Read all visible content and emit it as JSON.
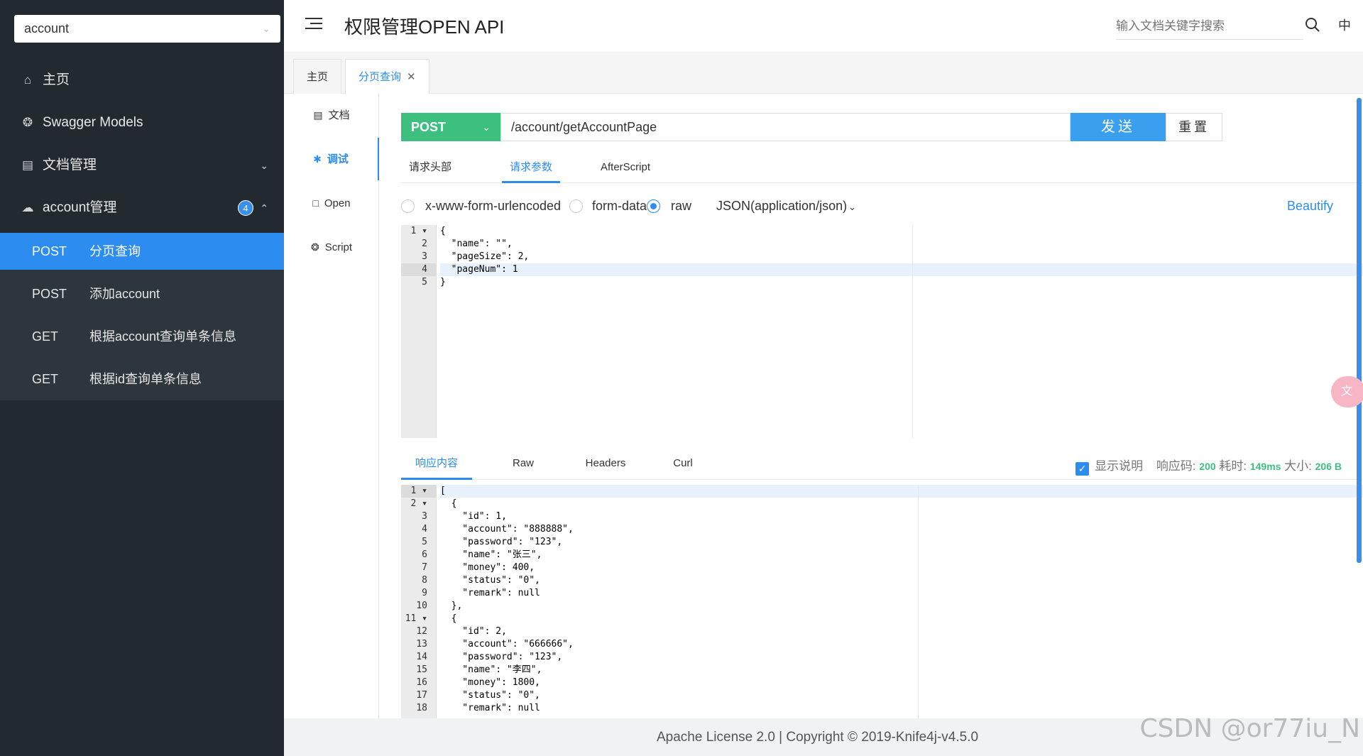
{
  "sidebar": {
    "group_select": "account",
    "items": [
      {
        "label": "主页",
        "icon": "home-icon"
      },
      {
        "label": "Swagger Models",
        "icon": "models-icon"
      },
      {
        "label": "文档管理",
        "icon": "doc-manage-icon"
      },
      {
        "label": "account管理",
        "icon": "cloud-icon",
        "badge": "4"
      }
    ],
    "apis": [
      {
        "method": "POST",
        "name": "分页查询",
        "active": true
      },
      {
        "method": "POST",
        "name": "添加account"
      },
      {
        "method": "GET",
        "name": "根据account查询单条信息"
      },
      {
        "method": "GET",
        "name": "根据id查询单条信息"
      }
    ]
  },
  "header": {
    "title": "权限管理OPEN API",
    "search_placeholder": "输入文档关键字搜索",
    "lang": "中"
  },
  "tabs": [
    {
      "label": "主页"
    },
    {
      "label": "分页查询",
      "active": true
    }
  ],
  "inner_nav": [
    {
      "label": "文档"
    },
    {
      "label": "调试",
      "active": true
    },
    {
      "label": "Open"
    },
    {
      "label": "Script"
    }
  ],
  "request": {
    "method": "POST",
    "url": "/account/getAccountPage",
    "send_label": "发送",
    "reset_label": "重置",
    "tabs": [
      "请求头部",
      "请求参数",
      "AfterScript"
    ],
    "active_tab": "请求参数",
    "body_types": [
      "x-www-form-urlencoded",
      "form-data",
      "raw"
    ],
    "selected_body_type": "raw",
    "content_type": "JSON(application/json)",
    "beautify_label": "Beautify",
    "body_lines": [
      "{",
      "  \"name\": \"\",",
      "  \"pageSize\": 2,",
      "  \"pageNum\": 1",
      "}"
    ]
  },
  "response": {
    "tabs": [
      "响应内容",
      "Raw",
      "Headers",
      "Curl"
    ],
    "active_tab": "响应内容",
    "show_desc_label": "显示说明",
    "show_desc_checked": true,
    "code_label": "响应码:",
    "code": "200",
    "time_label": "耗时:",
    "time": "149ms",
    "size_label": "大小:",
    "size": "206 B",
    "body_lines": [
      "[",
      "  {",
      "    \"id\": 1,",
      "    \"account\": \"888888\",",
      "    \"password\": \"123\",",
      "    \"name\": \"张三\",",
      "    \"money\": 400,",
      "    \"status\": \"0\",",
      "    \"remark\": null",
      "  },",
      "  {",
      "    \"id\": 2,",
      "    \"account\": \"666666\",",
      "    \"password\": \"123\",",
      "    \"name\": \"李四\",",
      "    \"money\": 1800,",
      "    \"status\": \"0\",",
      "    \"remark\": null"
    ]
  },
  "footer": {
    "license": "Apache License 2.0 | Copyright © 2019-Knife4j-v4.5.0"
  },
  "watermark": "CSDN @or77iu_N",
  "colors": {
    "sidebar_bg": "#22292f",
    "accent": "#2d8cf0",
    "post_green": "#3dbf7f",
    "send_blue": "#3b9ff0"
  }
}
